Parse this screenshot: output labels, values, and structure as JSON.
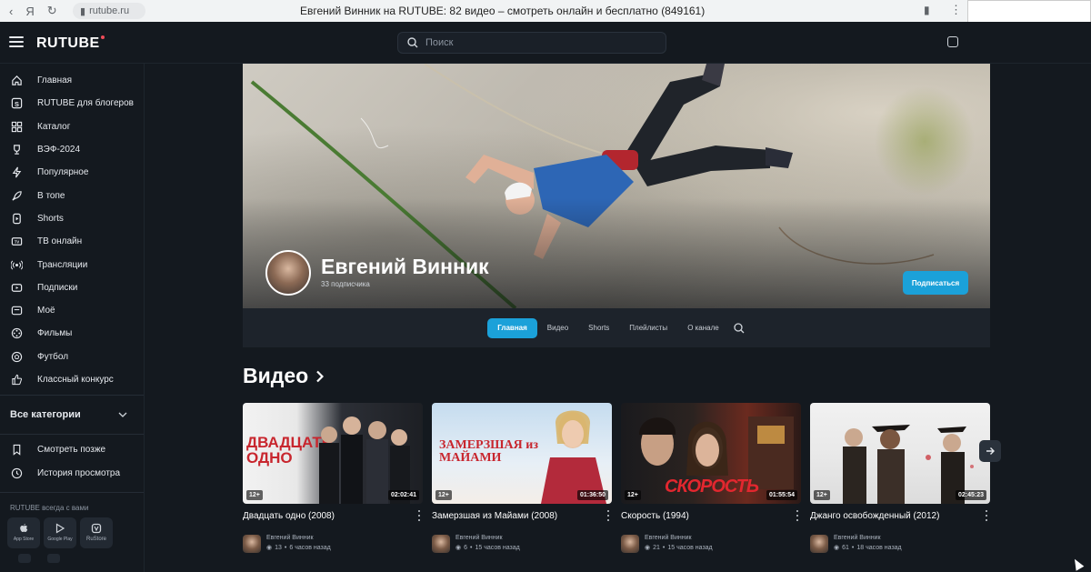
{
  "browser": {
    "url": "rutube.ru",
    "tab_title": "Евгений Винник на RUTUBE: 82 видео – смотреть онлайн и бесплатно (849161)"
  },
  "header": {
    "logo": "RUTUBE",
    "search_placeholder": "Поиск"
  },
  "sidebar": {
    "items": [
      {
        "label": "Главная",
        "icon": "home-icon"
      },
      {
        "label": "RUTUBE для блогеров",
        "icon": "studio-icon"
      },
      {
        "label": "Каталог",
        "icon": "grid-icon"
      },
      {
        "label": "ВЭФ-2024",
        "icon": "trophy-icon"
      },
      {
        "label": "Популярное",
        "icon": "lightning-icon"
      },
      {
        "label": "В топе",
        "icon": "rocket-icon"
      },
      {
        "label": "Shorts",
        "icon": "shorts-icon"
      },
      {
        "label": "ТВ онлайн",
        "icon": "tv-icon"
      },
      {
        "label": "Трансляции",
        "icon": "broadcast-icon"
      },
      {
        "label": "Подписки",
        "icon": "subscriptions-icon"
      },
      {
        "label": "Моё",
        "icon": "folder-icon"
      },
      {
        "label": "Фильмы",
        "icon": "film-icon"
      },
      {
        "label": "Футбол",
        "icon": "football-icon"
      },
      {
        "label": "Классный конкурс",
        "icon": "thumbs-up-icon"
      }
    ],
    "all_categories": "Все категории",
    "watch_later": "Смотреть позже",
    "history": "История просмотра",
    "rutube_everywhere": "RUTUBE всегда с вами",
    "stores": [
      "App Store",
      "Google Play",
      "RuStore"
    ]
  },
  "channel": {
    "name": "Евгений Винник",
    "subscribers": "33 подписчика",
    "subscribe_label": "Подписаться",
    "tabs": [
      "Главная",
      "Видео",
      "Shorts",
      "Плейлисты",
      "О канале"
    ],
    "active_tab": 0
  },
  "videos": {
    "section_title": "Видео",
    "items": [
      {
        "title": "Двадцать одно (2008)",
        "age": "12+",
        "duration": "02:02:41",
        "author": "Евгений Винник",
        "views": "13",
        "time": "6 часов назад",
        "thumb_text": "ДВАДЦАТЬ ОДНО"
      },
      {
        "title": "Замерзшая из Майами (2008)",
        "age": "12+",
        "duration": "01:36:50",
        "author": "Евгений Винник",
        "views": "6",
        "time": "15 часов назад",
        "thumb_text": "ЗАМЕРЗШАЯ из МАЙАМИ"
      },
      {
        "title": "Скорость (1994)",
        "age": "12+",
        "duration": "01:55:54",
        "author": "Евгений Винник",
        "views": "21",
        "time": "15 часов назад",
        "thumb_text": "СКОРОСТЬ"
      },
      {
        "title": "Джанго освобожденный (2012)",
        "age": "12+",
        "duration": "02:45:23",
        "author": "Евгений Винник",
        "views": "61",
        "time": "18 часов назад",
        "thumb_text": ""
      }
    ]
  },
  "colors": {
    "accent": "#1ba1d9",
    "bg": "#14191f",
    "logo_dot": "#ef4c59"
  }
}
